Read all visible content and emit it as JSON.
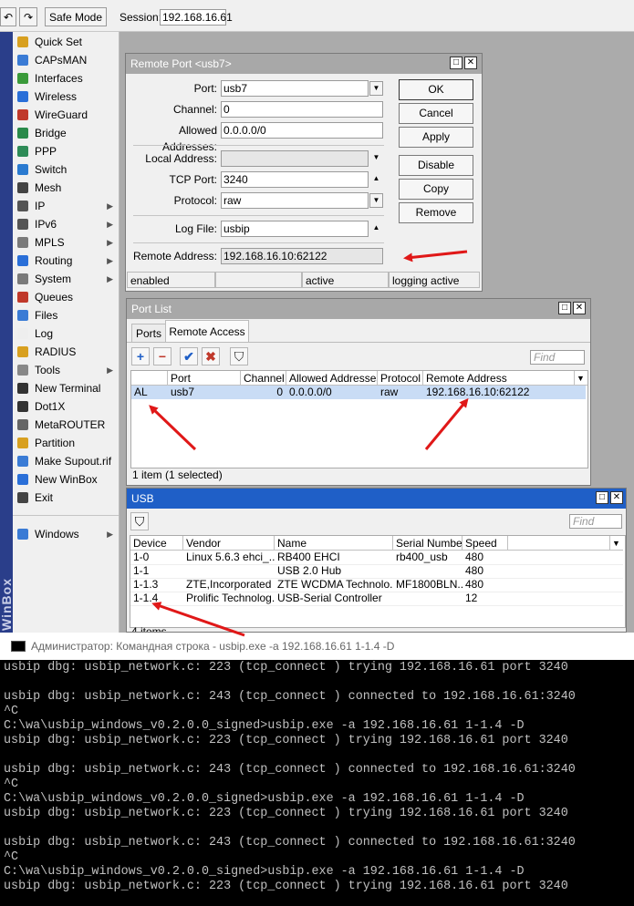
{
  "toolbar": {
    "undo_glyph": "↶",
    "redo_glyph": "↷",
    "safe_mode": "Safe Mode",
    "session_label": "Session:",
    "session_value": "192.168.16.61"
  },
  "sidebar": {
    "vertical_text": "WinBox",
    "items": [
      {
        "label": "Quick Set",
        "icon": "wand-icon",
        "color": "#d8a020"
      },
      {
        "label": "CAPsMAN",
        "icon": "capsman-icon",
        "color": "#3a7bd5"
      },
      {
        "label": "Interfaces",
        "icon": "interfaces-icon",
        "color": "#3a9a3a"
      },
      {
        "label": "Wireless",
        "icon": "wireless-icon",
        "color": "#2a6fd8"
      },
      {
        "label": "WireGuard",
        "icon": "wireguard-icon",
        "color": "#c0392b"
      },
      {
        "label": "Bridge",
        "icon": "bridge-icon",
        "color": "#2a8a4a"
      },
      {
        "label": "PPP",
        "icon": "ppp-icon",
        "color": "#2e8b57"
      },
      {
        "label": "Switch",
        "icon": "switch-icon",
        "color": "#2a7ad0"
      },
      {
        "label": "Mesh",
        "icon": "mesh-icon",
        "color": "#444444"
      },
      {
        "label": "IP",
        "icon": "ip-icon",
        "color": "#555555",
        "submenu": true
      },
      {
        "label": "IPv6",
        "icon": "ipv6-icon",
        "color": "#555555",
        "submenu": true
      },
      {
        "label": "MPLS",
        "icon": "mpls-icon",
        "color": "#7a7a7a",
        "submenu": true
      },
      {
        "label": "Routing",
        "icon": "routing-icon",
        "color": "#2a6fd8",
        "submenu": true
      },
      {
        "label": "System",
        "icon": "gear-icon",
        "color": "#7a7a7a",
        "submenu": true
      },
      {
        "label": "Queues",
        "icon": "queues-icon",
        "color": "#c0392b"
      },
      {
        "label": "Files",
        "icon": "folder-icon",
        "color": "#3a7bd5"
      },
      {
        "label": "Log",
        "icon": "log-icon",
        "color": "#eeeeee"
      },
      {
        "label": "RADIUS",
        "icon": "radius-icon",
        "color": "#d8a020"
      },
      {
        "label": "Tools",
        "icon": "tools-icon",
        "color": "#888888",
        "submenu": true
      },
      {
        "label": "New Terminal",
        "icon": "terminal-icon",
        "color": "#333333"
      },
      {
        "label": "Dot1X",
        "icon": "dot1x-icon",
        "color": "#333333"
      },
      {
        "label": "MetaROUTER",
        "icon": "metarouter-icon",
        "color": "#666666"
      },
      {
        "label": "Partition",
        "icon": "partition-icon",
        "color": "#d8a020"
      },
      {
        "label": "Make Supout.rif",
        "icon": "supout-icon",
        "color": "#3a7bd5"
      },
      {
        "label": "New WinBox",
        "icon": "winbox-icon",
        "color": "#2a6fd8"
      },
      {
        "label": "Exit",
        "icon": "exit-icon",
        "color": "#444444"
      },
      {
        "label": "Windows",
        "icon": "windows-icon",
        "color": "#3a7bd5",
        "submenu": true
      }
    ]
  },
  "remote_port": {
    "title": "Remote Port <usb7>",
    "labels": {
      "port": "Port:",
      "channel": "Channel:",
      "allowed": "Allowed Addresses:",
      "local": "Local Address:",
      "tcp_port": "TCP Port:",
      "protocol": "Protocol:",
      "log_file": "Log File:",
      "remote": "Remote Address:"
    },
    "values": {
      "port": "usb7",
      "channel": "0",
      "allowed": "0.0.0.0/0",
      "local": "",
      "tcp_port": "3240",
      "protocol": "raw",
      "log_file": "usbip",
      "remote": "192.168.16.10:62122"
    },
    "buttons": {
      "ok": "OK",
      "cancel": "Cancel",
      "apply": "Apply",
      "disable": "Disable",
      "copy": "Copy",
      "remove": "Remove"
    },
    "status": {
      "s1": "enabled",
      "s2": "",
      "s3": "active",
      "s4": "logging active"
    }
  },
  "port_list": {
    "title": "Port List",
    "tabs": [
      "Ports",
      "Remote Access"
    ],
    "find_placeholder": "Find",
    "headers": [
      "",
      "Port",
      "Channel",
      "Allowed Addresses",
      "Protocol",
      "Remote Address"
    ],
    "rows": [
      {
        "flags": "AL",
        "port": "usb7",
        "channel": "0",
        "allowed": "0.0.0.0/0",
        "protocol": "raw",
        "remote": "192.168.16.10:62122"
      }
    ],
    "footer": "1 item (1 selected)"
  },
  "usb": {
    "title": "USB",
    "find_placeholder": "Find",
    "headers": [
      "Device",
      "Vendor",
      "Name",
      "Serial Number",
      "Speed"
    ],
    "rows": [
      {
        "device": "1-0",
        "vendor": "Linux 5.6.3 ehci_...",
        "name": "RB400 EHCI",
        "serial": "rb400_usb",
        "speed": "480"
      },
      {
        "device": "1-1",
        "vendor": "",
        "name": "USB 2.0 Hub",
        "serial": "",
        "speed": "480"
      },
      {
        "device": "1-1.3",
        "vendor": "ZTE,Incorporated",
        "name": "ZTE WCDMA Technolo...",
        "serial": "MF1800BLN...",
        "speed": "480"
      },
      {
        "device": "1-1.4",
        "vendor": "Prolific Technolog...",
        "name": "USB-Serial Controller",
        "serial": "",
        "speed": "12"
      }
    ],
    "footer": "4 items"
  },
  "console": {
    "title": "Администратор: Командная строка - usbip.exe  -a 192.168.16.61 1-1.4 -D",
    "lines": [
      "usbip dbg: usbip_network.c: 223 (tcp_connect ) trying 192.168.16.61 port 3240",
      "",
      "usbip dbg: usbip_network.c: 243 (tcp_connect ) connected to 192.168.16.61:3240",
      "^C",
      "C:\\wa\\usbip_windows_v0.2.0.0_signed>usbip.exe -a 192.168.16.61 1-1.4 -D",
      "usbip dbg: usbip_network.c: 223 (tcp_connect ) trying 192.168.16.61 port 3240",
      "",
      "usbip dbg: usbip_network.c: 243 (tcp_connect ) connected to 192.168.16.61:3240",
      "^C",
      "C:\\wa\\usbip_windows_v0.2.0.0_signed>usbip.exe -a 192.168.16.61 1-1.4 -D",
      "usbip dbg: usbip_network.c: 223 (tcp_connect ) trying 192.168.16.61 port 3240",
      "",
      "usbip dbg: usbip_network.c: 243 (tcp_connect ) connected to 192.168.16.61:3240",
      "^C",
      "C:\\wa\\usbip_windows_v0.2.0.0_signed>usbip.exe -a 192.168.16.61 1-1.4 -D",
      "usbip dbg: usbip_network.c: 223 (tcp_connect ) trying 192.168.16.61 port 3240"
    ]
  },
  "colors": {
    "accent_blue": "#1f5fc7",
    "selected_row": "#c9dcf5",
    "annotation_red": "#e01818"
  }
}
